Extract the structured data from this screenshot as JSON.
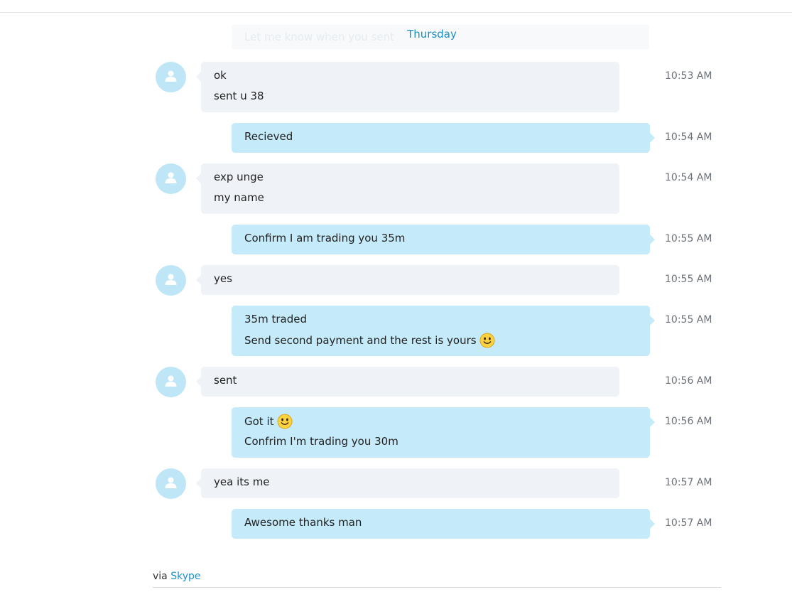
{
  "ghost_preview": "Let me know when you sent",
  "date_separator": "Thursday",
  "messages": [
    {
      "dir": "in",
      "lines": [
        "ok",
        "sent u 38"
      ],
      "time": "10:53 AM"
    },
    {
      "dir": "out",
      "lines": [
        "Recieved"
      ],
      "time": "10:54 AM"
    },
    {
      "dir": "in",
      "lines": [
        "exp unge",
        "my name"
      ],
      "time": "10:54 AM"
    },
    {
      "dir": "out",
      "lines": [
        "Confirm I am trading you 35m"
      ],
      "time": "10:55 AM"
    },
    {
      "dir": "in",
      "lines": [
        "yes"
      ],
      "time": "10:55 AM"
    },
    {
      "dir": "out",
      "lines": [
        "35m traded",
        "Send second payment and the rest is yours"
      ],
      "time": "10:55 AM"
    },
    {
      "dir": "in",
      "lines": [
        "sent"
      ],
      "time": "10:56 AM"
    },
    {
      "dir": "out",
      "lines": [
        "Got it",
        "Confrim I'm trading you 30m"
      ],
      "time": "10:56 AM"
    },
    {
      "dir": "in",
      "lines": [
        "yea its me"
      ],
      "time": "10:57 AM"
    },
    {
      "dir": "out",
      "lines": [
        "Awesome thanks man"
      ],
      "time": "10:57 AM"
    }
  ],
  "footer": {
    "via": "via",
    "link": "Skype"
  },
  "colors": {
    "incoming_bubble": "#eff2f6",
    "outgoing_bubble": "#c5eaf9",
    "avatar": "#bfe6f7",
    "link": "#1b8fc6"
  },
  "icons": {
    "avatar": "user-silhouette-icon",
    "emoji": "smile-emoji-icon"
  }
}
